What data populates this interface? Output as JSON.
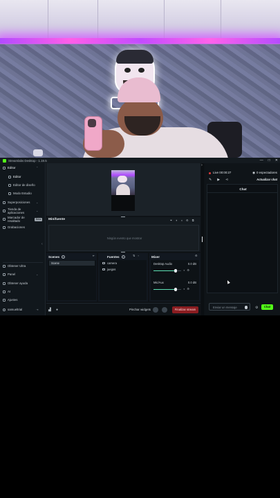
{
  "window": {
    "title": "Streamlabs Desktop - 1.19.5",
    "controls": [
      "—",
      "□",
      "✕"
    ]
  },
  "sidebar": {
    "items": [
      {
        "label": "Editor"
      },
      {
        "label": "Editor"
      },
      {
        "label": "Editor de diseño"
      },
      {
        "label": "Modo Estudio"
      },
      {
        "label": "Superposiciones"
      },
      {
        "label": "Tienda de aplicaciones"
      },
      {
        "label": "Marcador de resaltado",
        "badge": "Beta"
      },
      {
        "label": "Grabaciones"
      },
      {
        "label": "Obtener Ultra"
      },
      {
        "label": "Panel"
      },
      {
        "label": "Obtener ayuda"
      },
      {
        "label": "AI"
      },
      {
        "label": "Ajustes"
      },
      {
        "label": "samueltrial"
      }
    ]
  },
  "mini_feed": {
    "title": "Minifuente",
    "empty_text": "Ningún evento que mostrar"
  },
  "scenes": {
    "title": "Scenes",
    "items": [
      "Scene"
    ]
  },
  "sources": {
    "title": "Fuentes",
    "items": [
      "camera",
      "juegos"
    ]
  },
  "mixer": {
    "title": "Mixer",
    "channels": [
      {
        "name": "Desktop Audio",
        "db": "0.0 dB",
        "level": 0.8
      },
      {
        "name": "Mic/Aux",
        "db": "0.0 dB",
        "level": 0.8
      }
    ]
  },
  "footer": {
    "pin_label": "Pinchar widgets",
    "end_stream": "Finalizar stream"
  },
  "stream": {
    "live_time": "Live 00:00:27",
    "viewers": "0 espectadores",
    "update_chat": "Actualizar chat"
  },
  "chat": {
    "title": "Chat",
    "placeholder": "Enviar un mensaje",
    "send": "Chat"
  },
  "colors": {
    "accent": "#53fc18",
    "danger": "#8b1d21",
    "live": "#e03b3b"
  },
  "icons": [
    "search-icon",
    "pencil-icon",
    "play-icon",
    "share-icon",
    "gear-icon",
    "eye-icon",
    "emoji-icon"
  ]
}
